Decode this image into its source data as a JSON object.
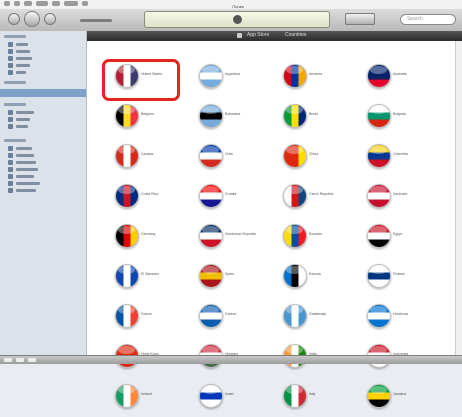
{
  "window": {
    "title": "iTunes"
  },
  "search": {
    "placeholder": "Search"
  },
  "browse_bar": {
    "left_label": "App Store",
    "right_label": "Countries"
  },
  "highlight_color": "#e52320",
  "countries": [
    {
      "name": "United States",
      "icon": "flag-us-icon",
      "colors": [
        "#b22234",
        "#ffffff",
        "#3c3b6e"
      ]
    },
    {
      "name": "Argentina",
      "icon": "flag-ar-icon",
      "colors": [
        "#74acdf",
        "#ffffff",
        "#74acdf"
      ]
    },
    {
      "name": "Armenia",
      "icon": "flag-am-icon",
      "colors": [
        "#d90012",
        "#0033a0",
        "#f2a800"
      ]
    },
    {
      "name": "Australia",
      "icon": "flag-au-icon",
      "colors": [
        "#012169",
        "#012169",
        "#e4002b"
      ]
    },
    {
      "name": "Belgium",
      "icon": "flag-be-icon",
      "colors": [
        "#000000",
        "#fdda24",
        "#ef3340"
      ]
    },
    {
      "name": "Botswana",
      "icon": "flag-bw-icon",
      "colors": [
        "#75aadb",
        "#000000",
        "#75aadb"
      ]
    },
    {
      "name": "Brazil",
      "icon": "flag-br-icon",
      "colors": [
        "#009c3b",
        "#ffdf00",
        "#002776"
      ]
    },
    {
      "name": "Bulgaria",
      "icon": "flag-bg-icon",
      "colors": [
        "#ffffff",
        "#00966e",
        "#d62612"
      ]
    },
    {
      "name": "Canada",
      "icon": "flag-ca-icon",
      "colors": [
        "#d52b1e",
        "#ffffff",
        "#d52b1e"
      ]
    },
    {
      "name": "Chile",
      "icon": "flag-cl-icon",
      "colors": [
        "#0039a6",
        "#ffffff",
        "#d52b1e"
      ]
    },
    {
      "name": "China",
      "icon": "flag-cn-icon",
      "colors": [
        "#de2910",
        "#de2910",
        "#ffde00"
      ]
    },
    {
      "name": "Colombia",
      "icon": "flag-co-icon",
      "colors": [
        "#fcd116",
        "#003893",
        "#ce1126"
      ]
    },
    {
      "name": "Costa Rica",
      "icon": "flag-cr-icon",
      "colors": [
        "#002b7f",
        "#ce1126",
        "#002b7f"
      ]
    },
    {
      "name": "Croatia",
      "icon": "flag-hr-icon",
      "colors": [
        "#ff0000",
        "#ffffff",
        "#171796"
      ]
    },
    {
      "name": "Czech Republic",
      "icon": "flag-cz-icon",
      "colors": [
        "#ffffff",
        "#d7141a",
        "#11457e"
      ]
    },
    {
      "name": "Denmark",
      "icon": "flag-dk-icon",
      "colors": [
        "#c8102e",
        "#ffffff",
        "#c8102e"
      ]
    },
    {
      "name": "Germany",
      "icon": "flag-de-icon",
      "colors": [
        "#000000",
        "#dd0000",
        "#ffce00"
      ]
    },
    {
      "name": "Dominican Republic",
      "icon": "flag-do-icon",
      "colors": [
        "#002d62",
        "#ffffff",
        "#ce1126"
      ]
    },
    {
      "name": "Ecuador",
      "icon": "flag-ec-icon",
      "colors": [
        "#ffdd00",
        "#034ea2",
        "#ed1c24"
      ]
    },
    {
      "name": "Egypt",
      "icon": "flag-eg-icon",
      "colors": [
        "#ce1126",
        "#ffffff",
        "#000000"
      ]
    },
    {
      "name": "El Salvador",
      "icon": "flag-sv-icon",
      "colors": [
        "#0f47af",
        "#ffffff",
        "#0f47af"
      ]
    },
    {
      "name": "Spain",
      "icon": "flag-es-icon",
      "colors": [
        "#aa151b",
        "#f1bf00",
        "#aa151b"
      ]
    },
    {
      "name": "Estonia",
      "icon": "flag-ee-icon",
      "colors": [
        "#0072ce",
        "#000000",
        "#ffffff"
      ]
    },
    {
      "name": "Finland",
      "icon": "flag-fi-icon",
      "colors": [
        "#ffffff",
        "#003580",
        "#ffffff"
      ]
    },
    {
      "name": "France",
      "icon": "flag-fr-icon",
      "colors": [
        "#0055a4",
        "#ffffff",
        "#ef4135"
      ]
    },
    {
      "name": "Greece",
      "icon": "flag-gr-icon",
      "colors": [
        "#0d5eaf",
        "#ffffff",
        "#0d5eaf"
      ]
    },
    {
      "name": "Guatemala",
      "icon": "flag-gt-icon",
      "colors": [
        "#4997d0",
        "#ffffff",
        "#4997d0"
      ]
    },
    {
      "name": "Honduras",
      "icon": "flag-hn-icon",
      "colors": [
        "#0073cf",
        "#ffffff",
        "#0073cf"
      ]
    },
    {
      "name": "Hong Kong",
      "icon": "flag-hk-icon",
      "colors": [
        "#de2910",
        "#de2910",
        "#de2910"
      ]
    },
    {
      "name": "Hungary",
      "icon": "flag-hu-icon",
      "colors": [
        "#cd2a3e",
        "#ffffff",
        "#436f4d"
      ]
    },
    {
      "name": "India",
      "icon": "flag-in-icon",
      "colors": [
        "#ff9933",
        "#ffffff",
        "#138808"
      ]
    },
    {
      "name": "Indonesia",
      "icon": "flag-id-icon",
      "colors": [
        "#ce1126",
        "#ffffff",
        "#ffffff"
      ]
    },
    {
      "name": "Ireland",
      "icon": "flag-ie-icon",
      "colors": [
        "#169b62",
        "#ffffff",
        "#ff883e"
      ]
    },
    {
      "name": "Israel",
      "icon": "flag-il-icon",
      "colors": [
        "#ffffff",
        "#0038b8",
        "#ffffff"
      ]
    },
    {
      "name": "Italy",
      "icon": "flag-it-icon",
      "colors": [
        "#009246",
        "#ffffff",
        "#ce2b37"
      ]
    },
    {
      "name": "Jamaica",
      "icon": "flag-jm-icon",
      "colors": [
        "#009b3a",
        "#fed100",
        "#000000"
      ]
    }
  ]
}
